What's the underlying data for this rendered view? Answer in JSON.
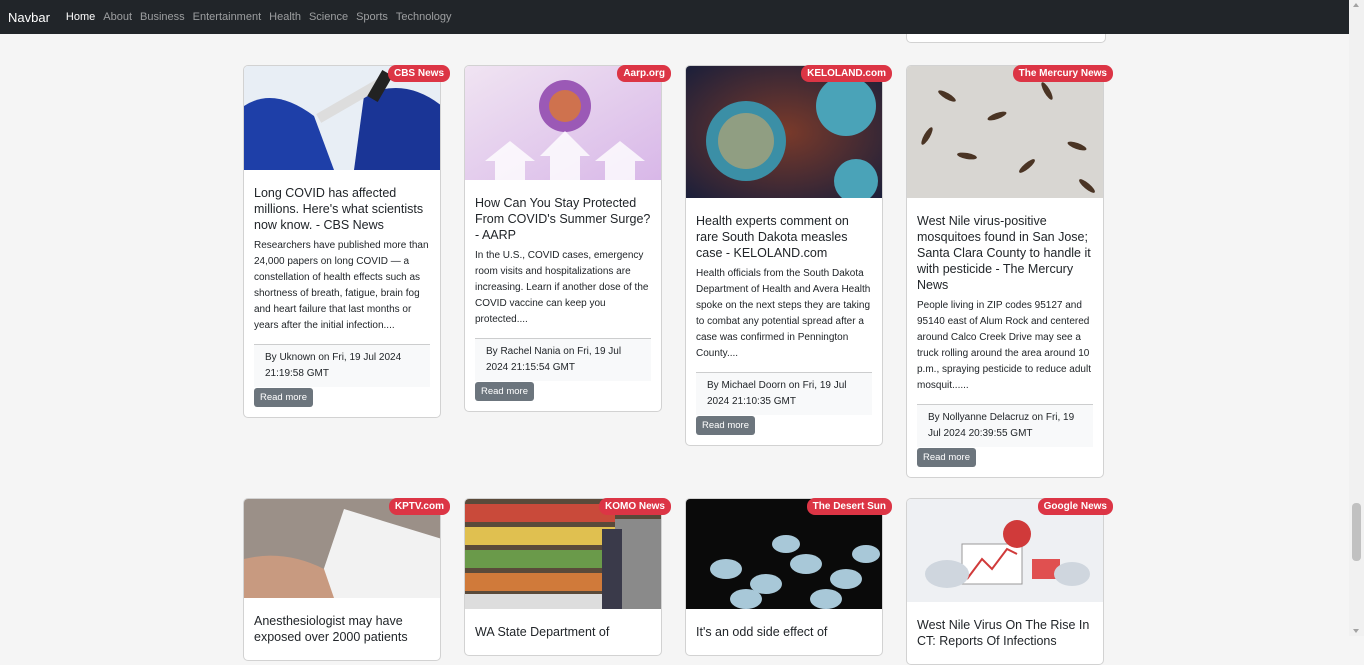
{
  "navbar": {
    "brand": "Navbar",
    "links": [
      "Home",
      "About",
      "Business",
      "Entertainment",
      "Health",
      "Science",
      "Sports",
      "Technology"
    ],
    "active": "Home"
  },
  "articles": [
    {
      "source": "CBS News",
      "title": "Long COVID has affected millions. Here's what scientists now know. - CBS News",
      "description": "Researchers have published more than 24,000 papers on long COVID — a constellation of health effects such as shortness of breath, fatigue, brain fog and heart failure that last months or years after the initial infection....",
      "byline": "By Uknown on Fri, 19 Jul 2024 21:19:58 GMT",
      "button": "Read more"
    },
    {
      "source": "Aarp.org",
      "title": "How Can You Stay Protected From COVID's Summer Surge? - AARP",
      "description": "In the U.S., COVID cases, emergency room visits and hospitalizations are increasing. Learn if another dose of the COVID vaccine can keep you protected....",
      "byline": "By Rachel Nania on Fri, 19 Jul 2024 21:15:54 GMT",
      "button": "Read more"
    },
    {
      "source": "KELOLAND.com",
      "title": "Health experts comment on rare South Dakota measles case - KELOLAND.com",
      "description": "Health officials from the South Dakota Department of Health and Avera Health spoke on the next steps they are taking to combat any potential spread after a case was confirmed in Pennington County....",
      "byline": "By Michael Doorn on Fri, 19 Jul 2024 21:10:35 GMT",
      "button": "Read more"
    },
    {
      "source": "The Mercury News",
      "title": "West Nile virus-positive mosquitoes found in San Jose; Santa Clara County to handle it with pesticide - The Mercury News",
      "description": "People living in ZIP codes 95127 and 95140 east of Alum Rock and centered around Calco Creek Drive may see a truck rolling around the area around 10 p.m., spraying pesticide to reduce adult mosquit......",
      "byline": "By Nollyanne Delacruz on Fri, 19 Jul 2024 20:39:55 GMT",
      "button": "Read more"
    },
    {
      "source": "KPTV.com",
      "title": "Anesthesiologist may have exposed over 2000 patients"
    },
    {
      "source": "KOMO News",
      "title": "WA State Department of"
    },
    {
      "source": "The Desert Sun",
      "title": "It's an odd side effect of"
    },
    {
      "source": "Google News",
      "title": "West Nile Virus On The Rise In CT: Reports Of Infections"
    }
  ]
}
